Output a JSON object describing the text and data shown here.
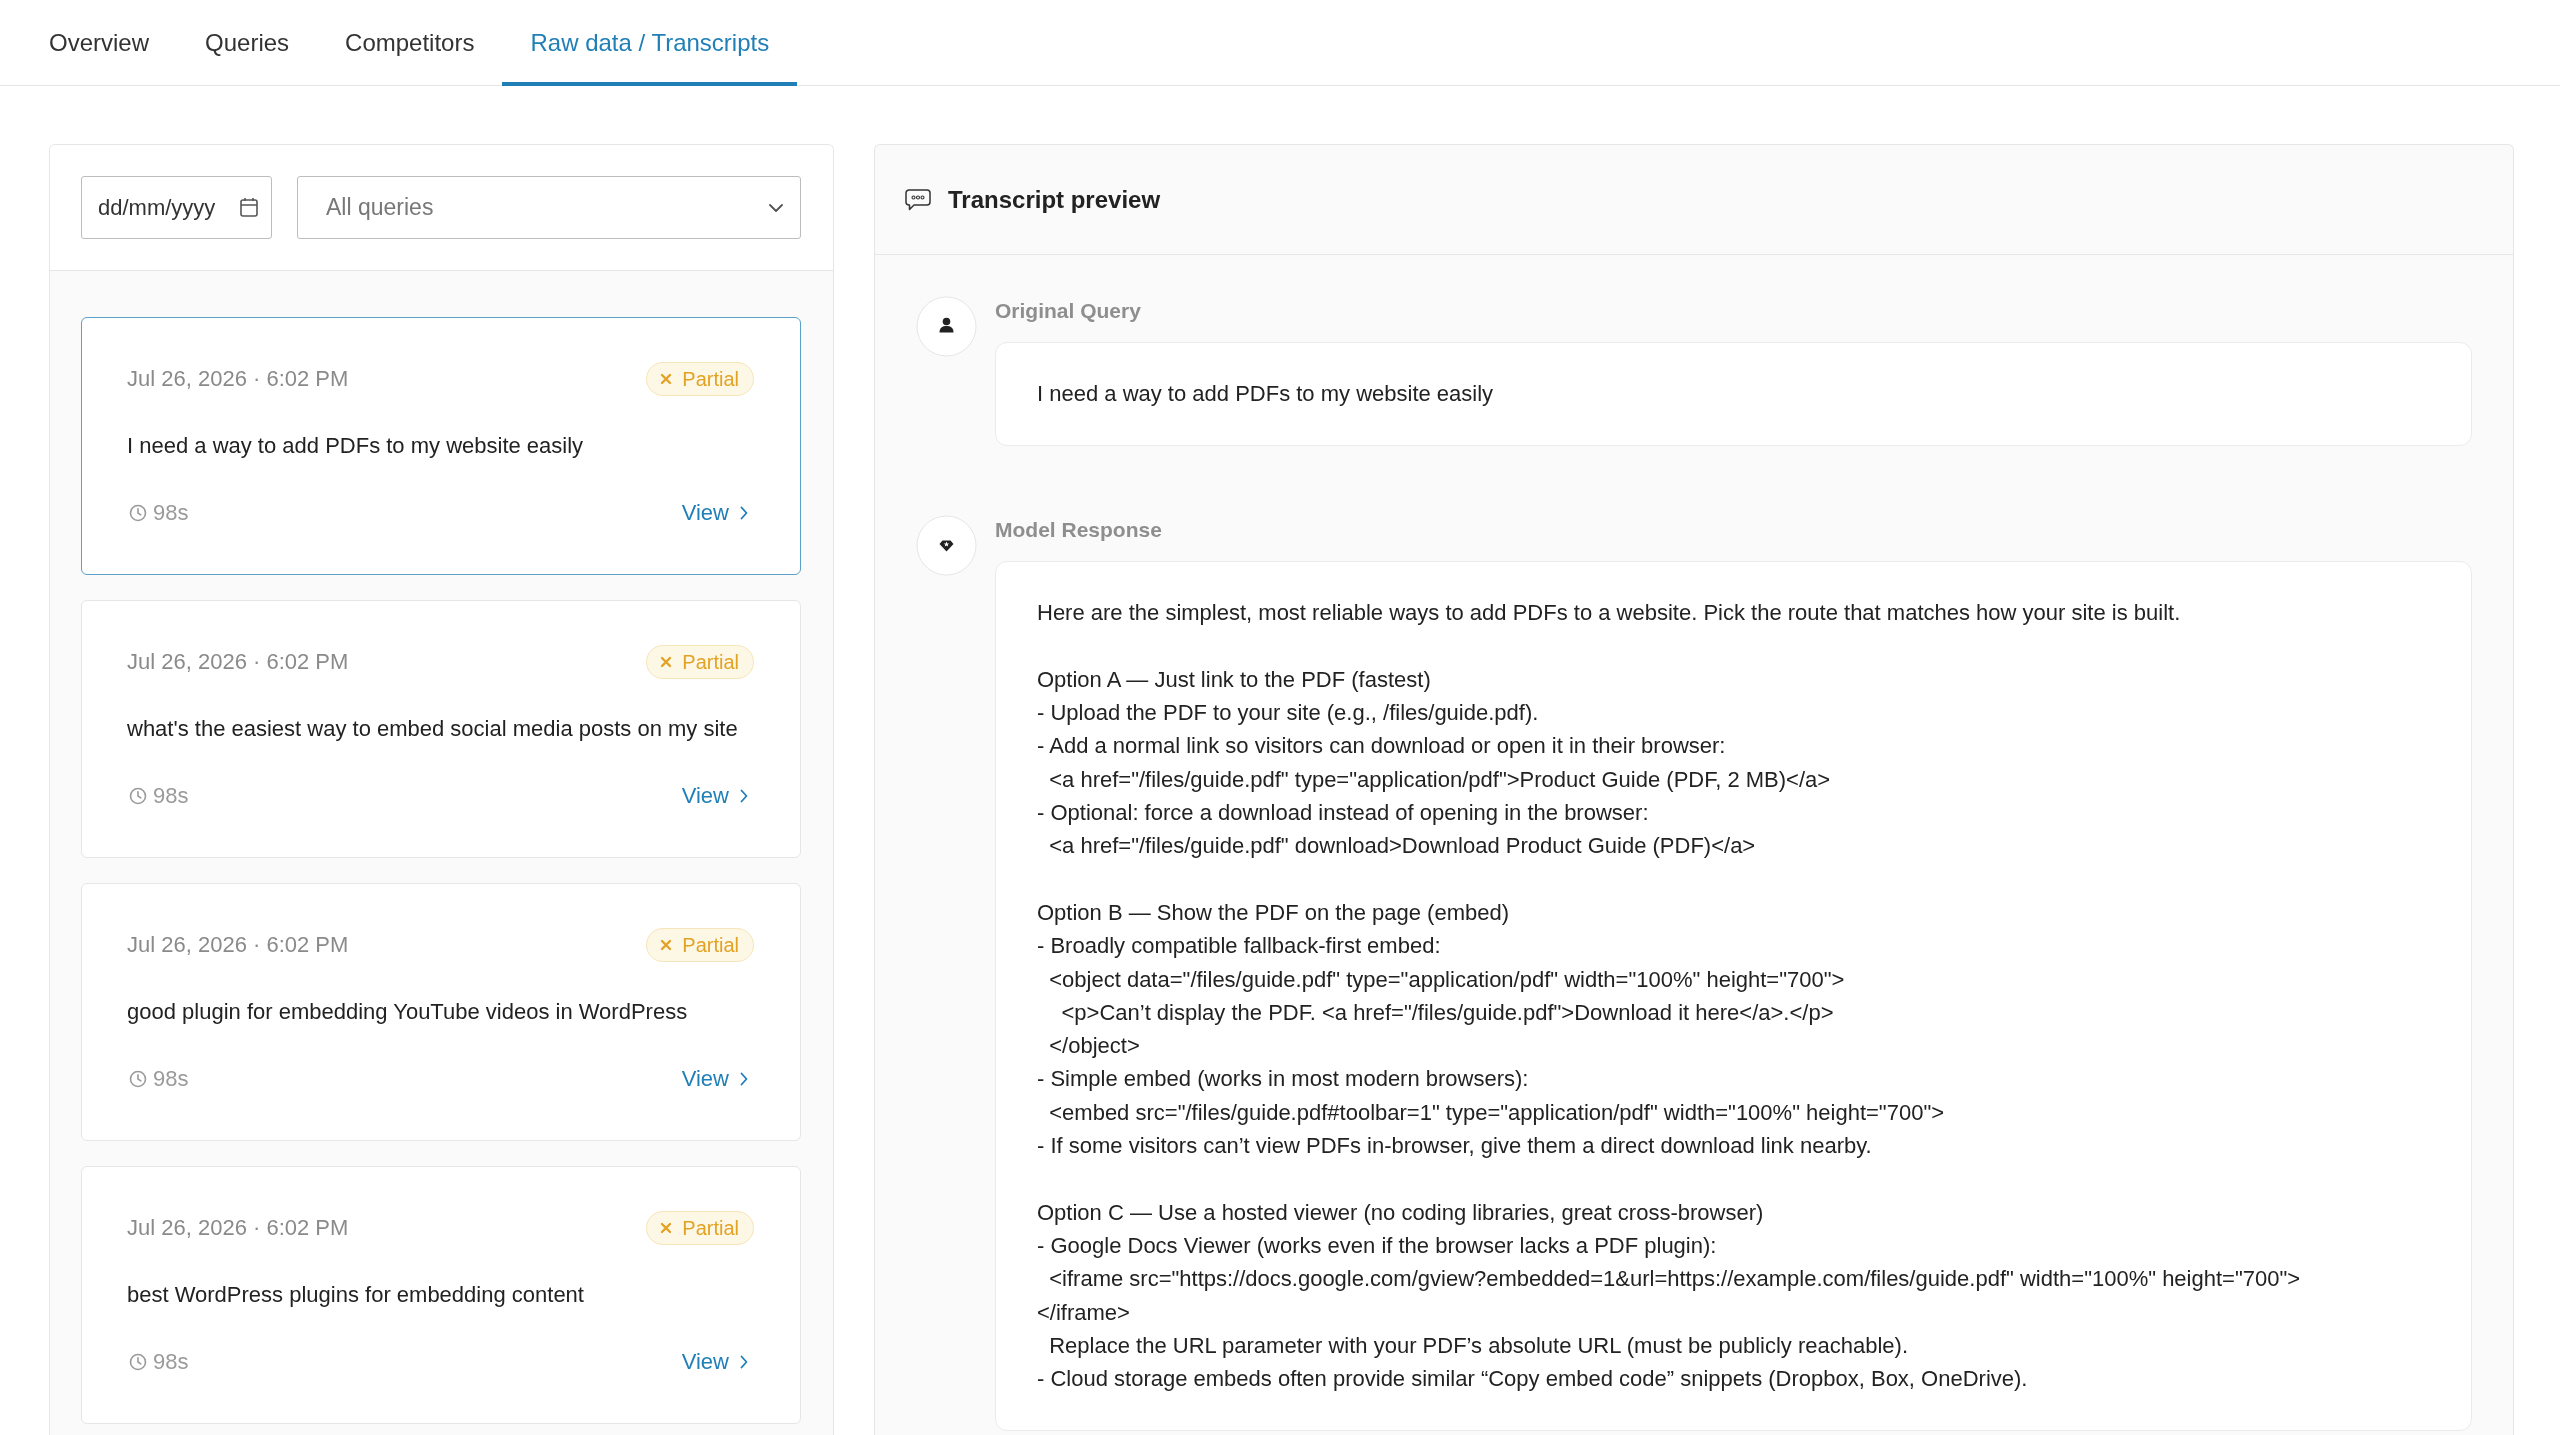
{
  "tabs": [
    {
      "label": "Overview",
      "selected": false
    },
    {
      "label": "Queries",
      "selected": false
    },
    {
      "label": "Competitors",
      "selected": false
    },
    {
      "label": "Raw data / Transcripts",
      "selected": true
    }
  ],
  "filters": {
    "date": {
      "placeholder": "dd/mm/yyyy"
    },
    "query_select": {
      "value": "All queries"
    }
  },
  "transcripts": [
    {
      "timestamp": "Jul 26, 2026 · 6:02 PM",
      "status": {
        "kind": "partial",
        "label": "Partial"
      },
      "query": "I need a way to add PDFs to my website easily",
      "duration": "98s",
      "action": "View",
      "selected": true
    },
    {
      "timestamp": "Jul 26, 2026 · 6:02 PM",
      "status": {
        "kind": "partial",
        "label": "Partial"
      },
      "query": "what's the easiest way to embed social media posts on my site",
      "duration": "98s",
      "action": "View",
      "selected": false
    },
    {
      "timestamp": "Jul 26, 2026 · 6:02 PM",
      "status": {
        "kind": "partial",
        "label": "Partial"
      },
      "query": "good plugin for embedding YouTube videos in WordPress",
      "duration": "98s",
      "action": "View",
      "selected": false
    },
    {
      "timestamp": "Jul 26, 2026 · 6:02 PM",
      "status": {
        "kind": "partial",
        "label": "Partial"
      },
      "query": "best WordPress plugins for embedding content",
      "duration": "98s",
      "action": "View",
      "selected": false
    }
  ],
  "preview": {
    "title": "Transcript preview",
    "messages": [
      {
        "kind": "user",
        "label": "Original Query",
        "paragraphs": [
          "I need a way to add PDFs to my website easily"
        ]
      },
      {
        "kind": "model",
        "label": "Model Response",
        "paragraphs": [
          "Here are the simplest, most reliable ways to add PDFs to a website. Pick the route that matches how your site is built.",
          "Option A — Just link to the PDF (fastest)\n- Upload the PDF to your site (e.g., /files/guide.pdf).\n- Add a normal link so visitors can download or open it in their browser:\n  <a href=\"/files/guide.pdf\" type=\"application/pdf\">Product Guide (PDF, 2 MB)</a>\n- Optional: force a download instead of opening in the browser:\n  <a href=\"/files/guide.pdf\" download>Download Product Guide (PDF)</a>",
          "Option B — Show the PDF on the page (embed)\n- Broadly compatible fallback-first embed:\n  <object data=\"/files/guide.pdf\" type=\"application/pdf\" width=\"100%\" height=\"700\">\n    <p>Can’t display the PDF. <a href=\"/files/guide.pdf\">Download it here</a>.</p>\n  </object>\n- Simple embed (works in most modern browsers):\n  <embed src=\"/files/guide.pdf#toolbar=1\" type=\"application/pdf\" width=\"100%\" height=\"700\">\n- If some visitors can’t view PDFs in-browser, give them a direct download link nearby.",
          "Option C — Use a hosted viewer (no coding libraries, great cross-browser)\n- Google Docs Viewer (works even if the browser lacks a PDF plugin):\n  <iframe src=\"https://docs.google.com/gview?embedded=1&url=https://example.com/files/guide.pdf\" width=\"100%\" height=\"700\">\n</iframe>\n  Replace the URL parameter with your PDF’s absolute URL (must be publicly reachable).\n- Cloud storage embeds often provide similar “Copy embed code” snippets (Dropbox, Box, OneDrive)."
        ]
      }
    ]
  }
}
